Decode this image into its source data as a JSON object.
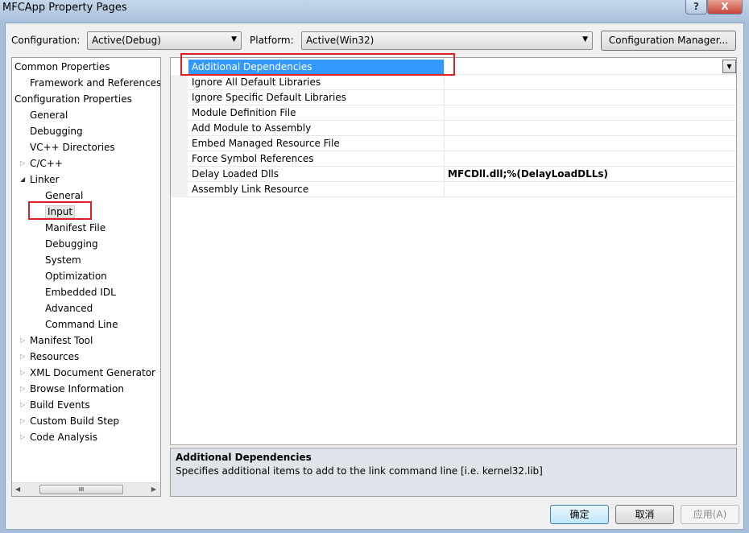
{
  "window": {
    "title": "MFCApp Property Pages",
    "help_label": "?",
    "close_label": "X"
  },
  "toolbar": {
    "configuration_label": "Configuration:",
    "configuration_value": "Active(Debug)",
    "platform_label": "Platform:",
    "platform_value": "Active(Win32)",
    "config_manager_label": "Configuration Manager..."
  },
  "tree": [
    {
      "label": "Common Properties",
      "level": 0,
      "expander": ""
    },
    {
      "label": "Framework and References",
      "level": 1,
      "expander": ""
    },
    {
      "label": "Configuration Properties",
      "level": 0,
      "expander": ""
    },
    {
      "label": "General",
      "level": 1,
      "expander": ""
    },
    {
      "label": "Debugging",
      "level": 1,
      "expander": ""
    },
    {
      "label": "VC++ Directories",
      "level": 1,
      "expander": ""
    },
    {
      "label": "C/C++",
      "level": 1,
      "expander": "collapsed"
    },
    {
      "label": "Linker",
      "level": 1,
      "expander": "expanded"
    },
    {
      "label": "General",
      "level": 2,
      "expander": ""
    },
    {
      "label": "Input",
      "level": 2,
      "expander": "",
      "selected": true
    },
    {
      "label": "Manifest File",
      "level": 2,
      "expander": ""
    },
    {
      "label": "Debugging",
      "level": 2,
      "expander": ""
    },
    {
      "label": "System",
      "level": 2,
      "expander": ""
    },
    {
      "label": "Optimization",
      "level": 2,
      "expander": ""
    },
    {
      "label": "Embedded IDL",
      "level": 2,
      "expander": ""
    },
    {
      "label": "Advanced",
      "level": 2,
      "expander": ""
    },
    {
      "label": "Command Line",
      "level": 2,
      "expander": ""
    },
    {
      "label": "Manifest Tool",
      "level": 1,
      "expander": "collapsed"
    },
    {
      "label": "Resources",
      "level": 1,
      "expander": "collapsed"
    },
    {
      "label": "XML Document Generator",
      "level": 1,
      "expander": "collapsed"
    },
    {
      "label": "Browse Information",
      "level": 1,
      "expander": "collapsed"
    },
    {
      "label": "Build Events",
      "level": 1,
      "expander": "collapsed"
    },
    {
      "label": "Custom Build Step",
      "level": 1,
      "expander": "collapsed"
    },
    {
      "label": "Code Analysis",
      "level": 1,
      "expander": "collapsed"
    }
  ],
  "properties": [
    {
      "name": "Additional Dependencies",
      "value": "",
      "selected": true
    },
    {
      "name": "Ignore All Default Libraries",
      "value": ""
    },
    {
      "name": "Ignore Specific Default Libraries",
      "value": ""
    },
    {
      "name": "Module Definition File",
      "value": ""
    },
    {
      "name": "Add Module to Assembly",
      "value": ""
    },
    {
      "name": "Embed Managed Resource File",
      "value": ""
    },
    {
      "name": "Force Symbol References",
      "value": ""
    },
    {
      "name": "Delay Loaded Dlls",
      "value": "MFCDll.dll;%(DelayLoadDLLs)"
    },
    {
      "name": "Assembly Link Resource",
      "value": ""
    }
  ],
  "description": {
    "title": "Additional Dependencies",
    "text": "Specifies additional items to add to the link command line [i.e. kernel32.lib]"
  },
  "buttons": {
    "ok": "确定",
    "cancel": "取消",
    "apply": "应用(A)"
  },
  "colors": {
    "selection": "#3399ff",
    "highlight_box": "#e02020"
  }
}
